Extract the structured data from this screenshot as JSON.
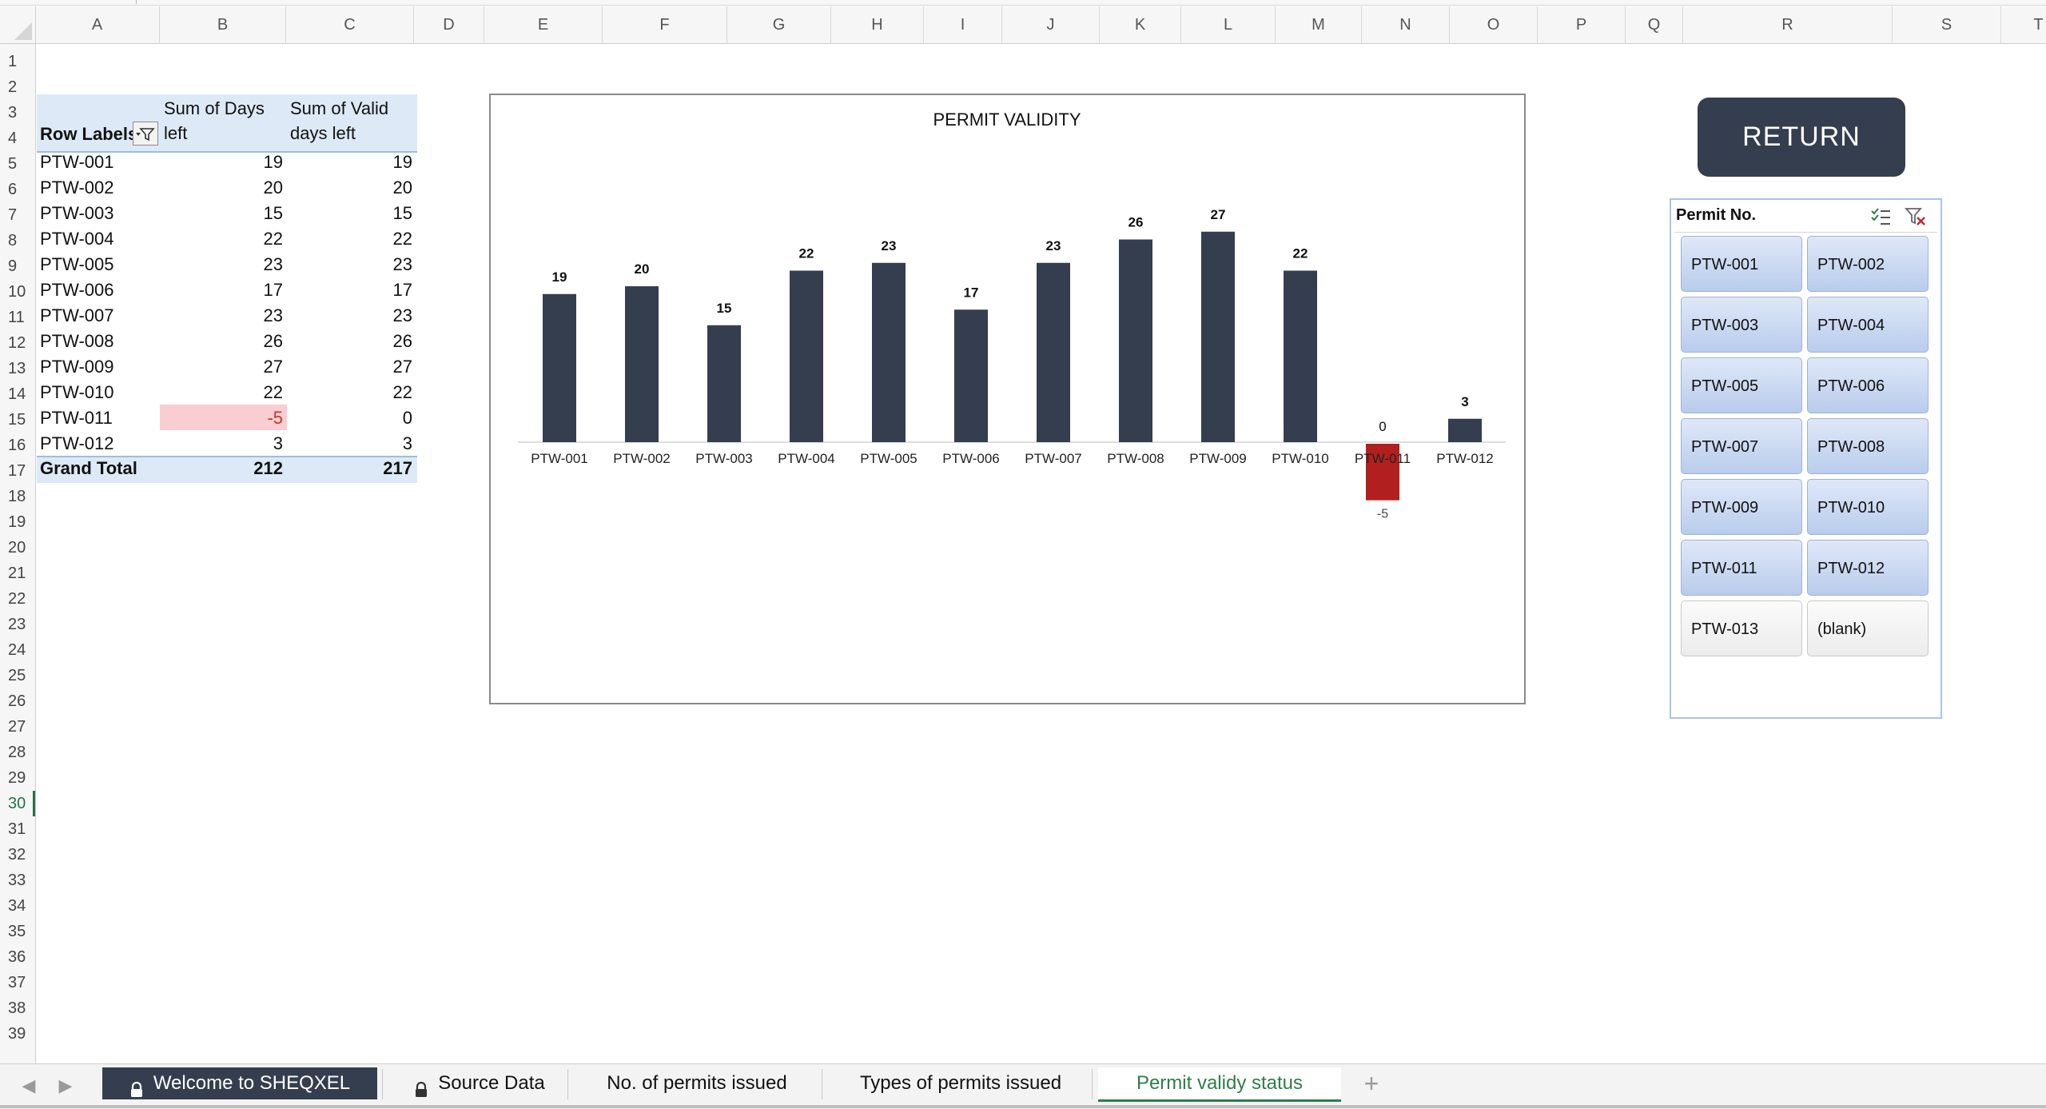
{
  "columns": [
    "A",
    "B",
    "C",
    "D",
    "E",
    "F",
    "G",
    "H",
    "I",
    "J",
    "K",
    "L",
    "M",
    "N",
    "O",
    "P",
    "Q",
    "R",
    "S",
    "T"
  ],
  "rows": [
    "1",
    "2",
    "3",
    "4",
    "5",
    "6",
    "7",
    "8",
    "9",
    "10",
    "11",
    "12",
    "13",
    "14",
    "15",
    "16",
    "17",
    "18",
    "19",
    "20",
    "21",
    "22",
    "23",
    "24",
    "25",
    "26",
    "27",
    "28",
    "29",
    "30",
    "31",
    "32",
    "33",
    "34",
    "35",
    "36",
    "37",
    "38",
    "39"
  ],
  "active_row": "30",
  "pivot": {
    "header_row_labels": "Row Labels",
    "header_days_1": "Sum of Days",
    "header_days_2": "left",
    "header_valid_1": "Sum of Valid",
    "header_valid_2": "days left",
    "rows": [
      {
        "label": "PTW-001",
        "days": "19",
        "valid": "19"
      },
      {
        "label": "PTW-002",
        "days": "20",
        "valid": "20"
      },
      {
        "label": "PTW-003",
        "days": "15",
        "valid": "15"
      },
      {
        "label": "PTW-004",
        "days": "22",
        "valid": "22"
      },
      {
        "label": "PTW-005",
        "days": "23",
        "valid": "23"
      },
      {
        "label": "PTW-006",
        "days": "17",
        "valid": "17"
      },
      {
        "label": "PTW-007",
        "days": "23",
        "valid": "23"
      },
      {
        "label": "PTW-008",
        "days": "26",
        "valid": "26"
      },
      {
        "label": "PTW-009",
        "days": "27",
        "valid": "27"
      },
      {
        "label": "PTW-010",
        "days": "22",
        "valid": "22"
      },
      {
        "label": "PTW-011",
        "days": "-5",
        "valid": "0"
      },
      {
        "label": "PTW-012",
        "days": "3",
        "valid": "3"
      }
    ],
    "total_label": "Grand Total",
    "total_days": "212",
    "total_valid": "217",
    "negative_color": "#f9cdd1"
  },
  "chart_data": {
    "type": "bar",
    "title": "PERMIT VALIDITY",
    "categories": [
      "PTW-001",
      "PTW-002",
      "PTW-003",
      "PTW-004",
      "PTW-005",
      "PTW-006",
      "PTW-007",
      "PTW-008",
      "PTW-009",
      "PTW-010",
      "PTW-011",
      "PTW-012"
    ],
    "series": [
      {
        "values": [
          19,
          20,
          15,
          22,
          23,
          17,
          23,
          26,
          27,
          22,
          -5,
          3
        ]
      },
      {
        "values": [
          19,
          20,
          15,
          22,
          23,
          17,
          23,
          26,
          27,
          22,
          0,
          3
        ]
      }
    ],
    "data_labels": [
      "19",
      "20",
      "15",
      "22",
      "23",
      "17",
      "23",
      "26",
      "27",
      "22",
      "0",
      "-5",
      "3"
    ],
    "bar_color": "#353e4e",
    "negative_bar_color": "#b21f1f",
    "ylim": [
      -6,
      29
    ],
    "grid": false,
    "legend": "none"
  },
  "return_button": {
    "label": "RETURN",
    "color": "#353e4e"
  },
  "slicer": {
    "title": "Permit No.",
    "items": [
      {
        "label": "PTW-001",
        "selected": true
      },
      {
        "label": "PTW-002",
        "selected": true
      },
      {
        "label": "PTW-003",
        "selected": true
      },
      {
        "label": "PTW-004",
        "selected": true
      },
      {
        "label": "PTW-005",
        "selected": true
      },
      {
        "label": "PTW-006",
        "selected": true
      },
      {
        "label": "PTW-007",
        "selected": true
      },
      {
        "label": "PTW-008",
        "selected": true
      },
      {
        "label": "PTW-009",
        "selected": true
      },
      {
        "label": "PTW-010",
        "selected": true
      },
      {
        "label": "PTW-011",
        "selected": true
      },
      {
        "label": "PTW-012",
        "selected": true
      },
      {
        "label": "PTW-013",
        "selected": false
      },
      {
        "label": "(blank)",
        "selected": false
      }
    ],
    "icons": [
      "multi-select-icon",
      "clear-filter-icon"
    ]
  },
  "tabs": [
    {
      "label": "Welcome to SHEQXEL",
      "locked": true
    },
    {
      "label": "Source Data",
      "locked": true
    },
    {
      "label": "No. of permits issued",
      "locked": false
    },
    {
      "label": "Types of permits issued",
      "locked": false
    },
    {
      "label": "Permit validy status",
      "locked": false
    }
  ],
  "active_tab": "Permit validy status",
  "add_sheet_label": "+",
  "accent_color": "#2e7d4a"
}
